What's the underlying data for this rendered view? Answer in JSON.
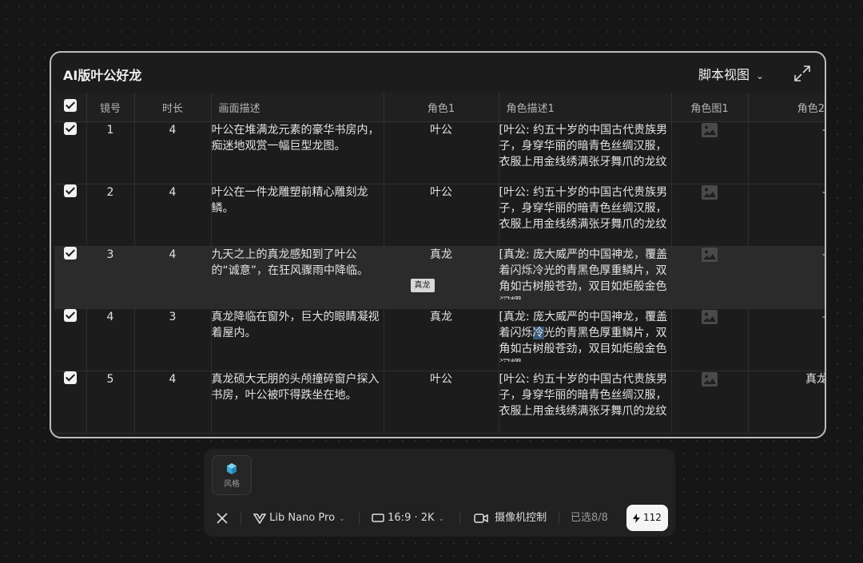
{
  "panel": {
    "title": "AI版叶公好龙",
    "view_label": "脚本视图"
  },
  "table": {
    "headers": {
      "index": "镜号",
      "duration": "时长",
      "description": "画面描述",
      "role1": "角色1",
      "role1_desc": "角色描述1",
      "role1_image": "角色图1",
      "role2": "角色2"
    },
    "rows": [
      {
        "index": "1",
        "duration": "4",
        "description": "叶公在堆满龙元素的豪华书房内，痴迷地观赏一幅巨型龙图。",
        "role1": "叶公",
        "role1_desc": "[叶公: 约五十岁的中国古代贵族男子，身穿华丽的暗青色丝绸汉服，衣服上用金线绣满张牙舞爪的龙纹",
        "role2": "–"
      },
      {
        "index": "2",
        "duration": "4",
        "description": "叶公在一件龙雕塑前精心雕刻龙鳞。",
        "role1": "叶公",
        "role1_desc": "[叶公: 约五十岁的中国古代贵族男子，身穿华丽的暗青色丝绸汉服，衣服上用金线绣满张牙舞爪的龙纹",
        "role2": "–"
      },
      {
        "index": "3",
        "duration": "4",
        "description": "九天之上的真龙感知到了叶公的“诚意”，在狂风骤雨中降临。",
        "role1": "真龙",
        "role1_tag": "真龙",
        "role1_desc": "[真龙: 庞大威严的中国神龙，覆盖着闪烁冷光的青黑色厚重鳞片，双角如古树般苍劲，双目如炬般金色闪耀",
        "role2": "–"
      },
      {
        "index": "4",
        "duration": "3",
        "description": "真龙降临在窗外，巨大的眼睛凝视着屋内。",
        "role1": "真龙",
        "role1_desc_a": "[真龙: 庞大威严的中国神龙，覆盖着闪烁",
        "role1_desc_sel": "冷",
        "role1_desc_b": "光的青黑色厚重鳞片，双角如古树般苍劲，双目如炬般金色闪耀",
        "role2": "–"
      },
      {
        "index": "5",
        "duration": "4",
        "description": "真龙硕大无朋的头颅撞碎窗户探入书房，叶公被吓得跌坐在地。",
        "role1": "叶公",
        "role1_desc": "[叶公: 约五十岁的中国古代贵族男子，身穿华丽的暗青色丝绸汉服，衣服上用金线绣满张牙舞爪的龙纹",
        "role2": "真龙"
      }
    ]
  },
  "bottom": {
    "style_label": "风格",
    "model_label": "Lib Nano Pro",
    "ratio_label": "16:9 · 2K",
    "camera_label": "摄像机控制",
    "selected_label": "已选8/8",
    "credits": "112"
  },
  "icons": [
    "checkbox-icon",
    "expand-icon",
    "chevron-down-icon",
    "image-placeholder-icon",
    "cube-icon",
    "close-icon",
    "model-logo-icon",
    "aspect-ratio-icon",
    "camera-icon",
    "lightning-icon"
  ]
}
